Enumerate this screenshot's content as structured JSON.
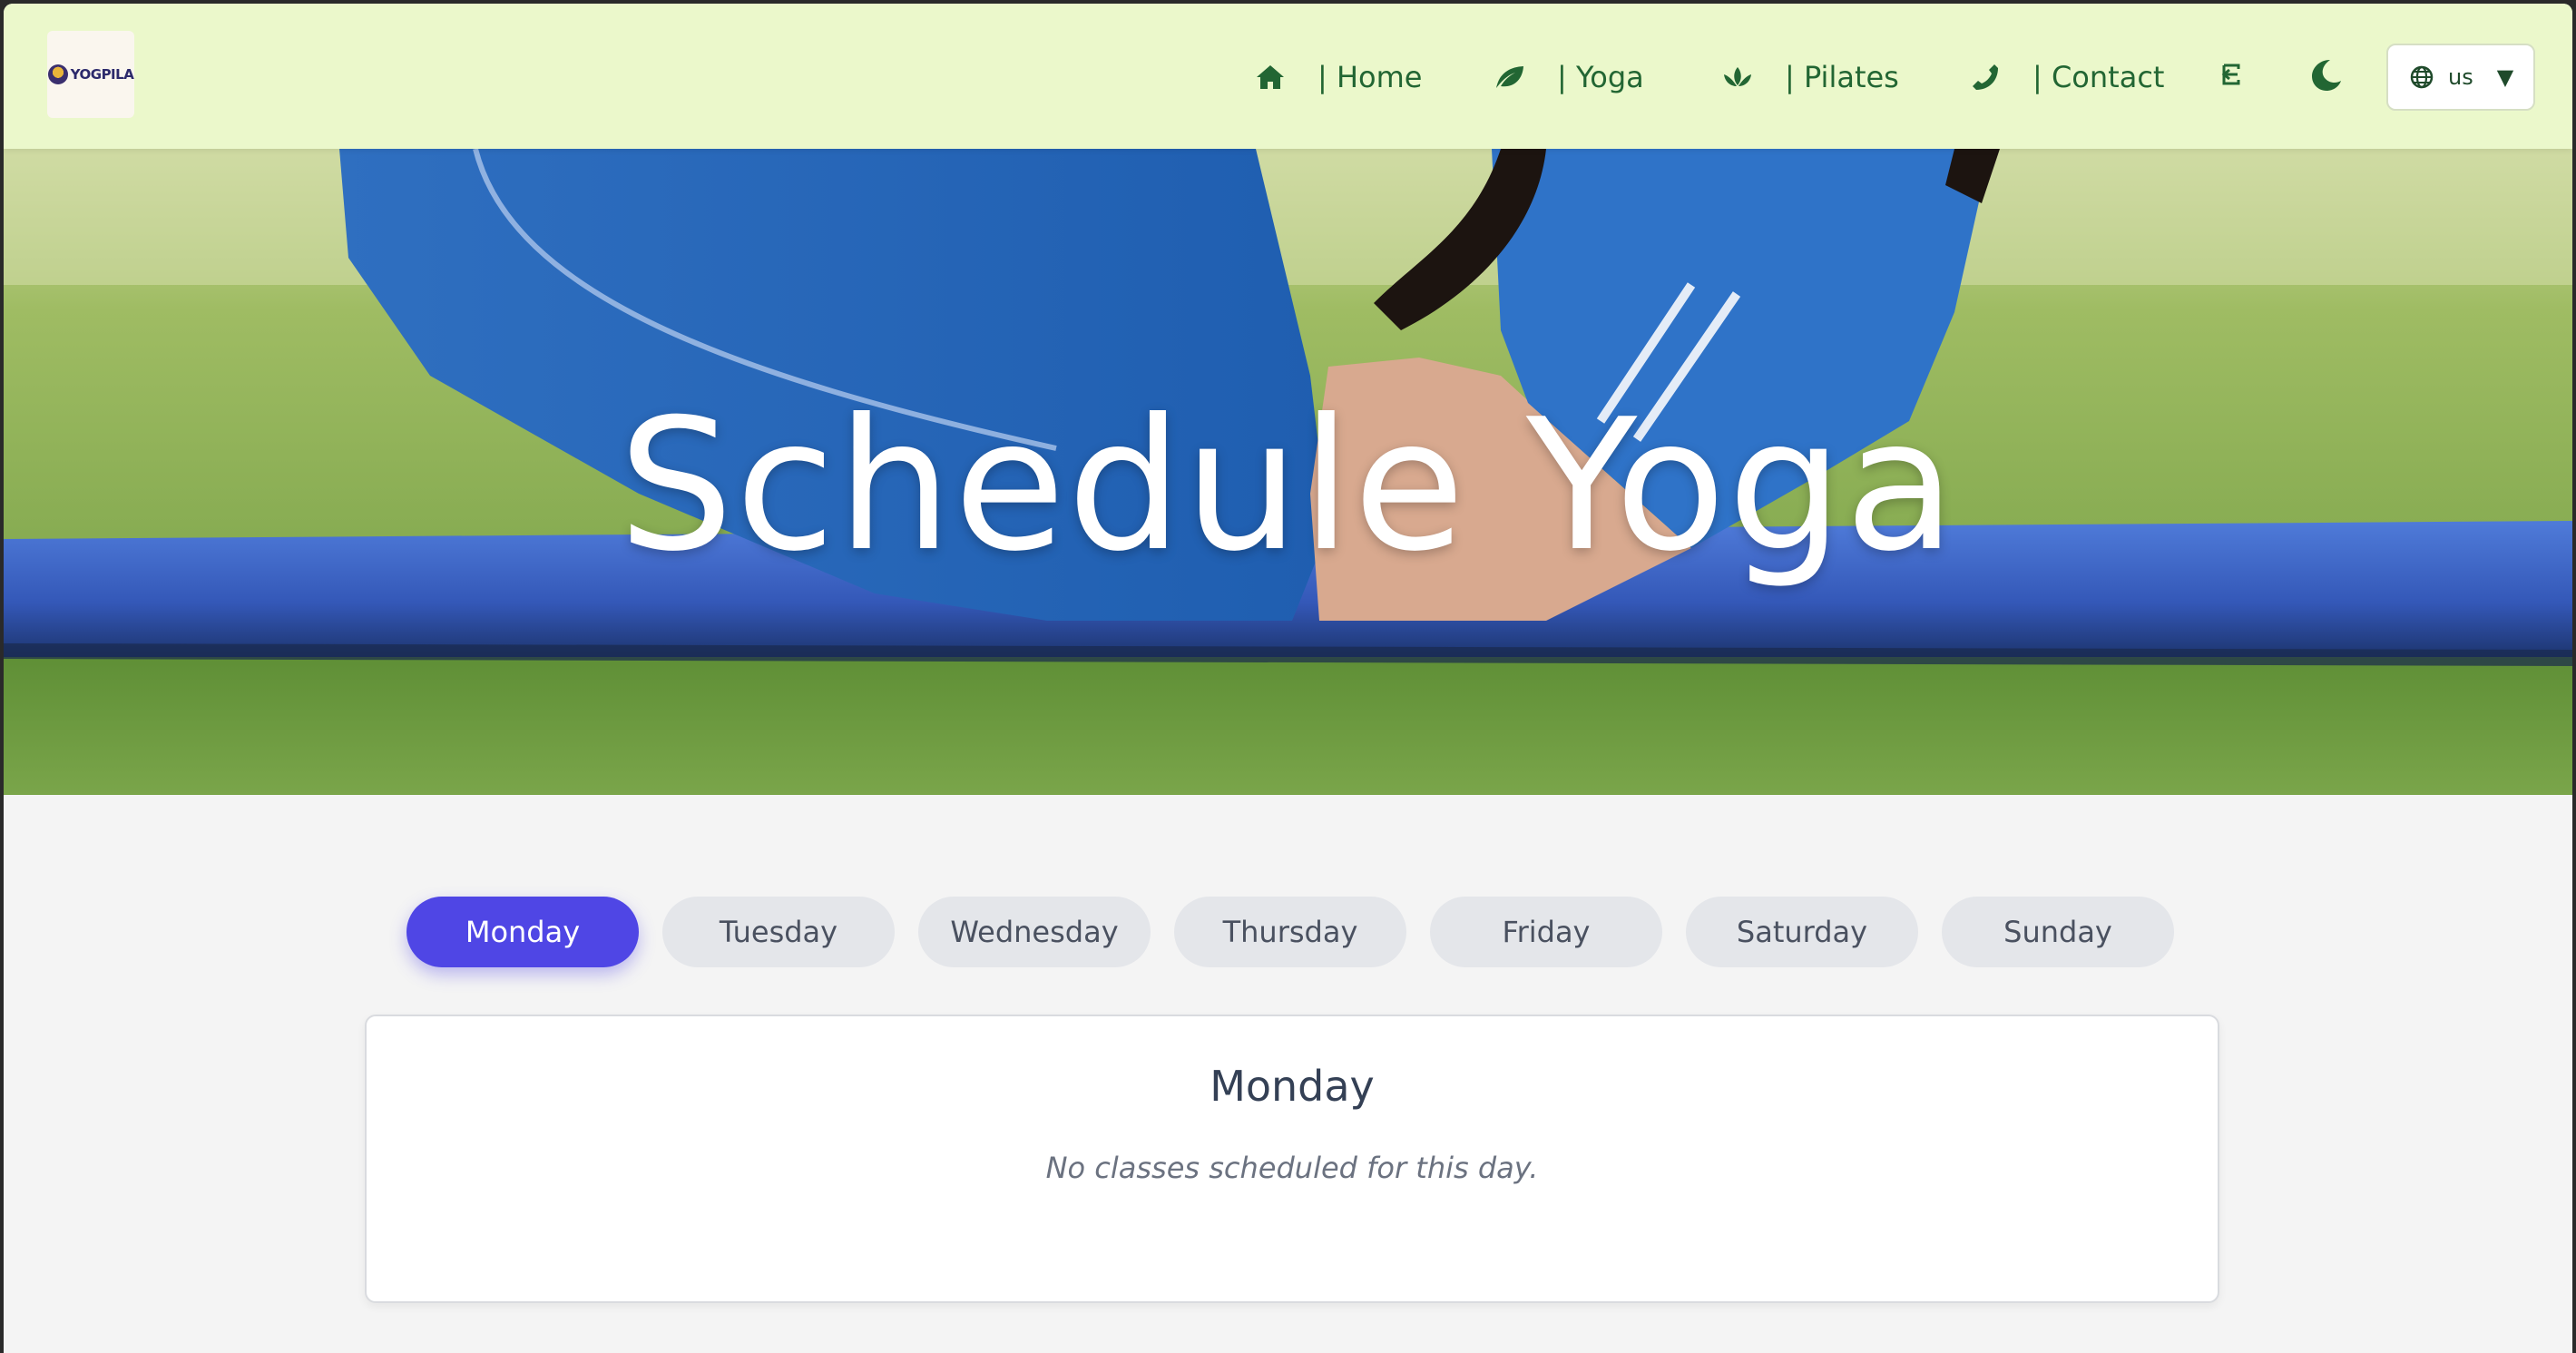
{
  "header": {
    "logo_text": "YOGPILA",
    "nav": [
      {
        "icon": "home-icon",
        "label": "| Home"
      },
      {
        "icon": "leaf-icon",
        "label": "| Yoga"
      },
      {
        "icon": "lotus-icon",
        "label": "| Pilates"
      },
      {
        "icon": "phone-icon",
        "label": "| Contact"
      }
    ],
    "login_icon": "login-icon",
    "theme_icon": "moon-icon",
    "language": {
      "icon": "globe-icon",
      "value": "us",
      "caret": "▼"
    }
  },
  "hero": {
    "title": "Schedule Yoga"
  },
  "schedule": {
    "days": [
      "Monday",
      "Tuesday",
      "Wednesday",
      "Thursday",
      "Friday",
      "Saturday",
      "Sunday"
    ],
    "selected_day": "Monday",
    "card": {
      "title": "Monday",
      "empty_message": "No classes scheduled for this day."
    }
  },
  "colors": {
    "header_bg": "#ebf8cb",
    "nav_green": "#226633",
    "active_tab": "#4f46e5",
    "tab_bg": "#e4e6ea",
    "page_bg": "#f4f4f4"
  }
}
